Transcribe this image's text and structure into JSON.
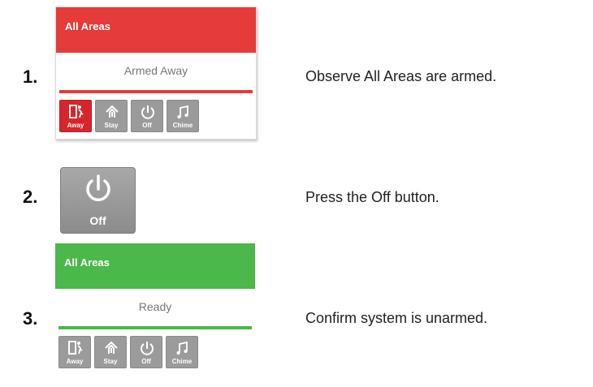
{
  "steps": [
    {
      "number": "1.",
      "text": "Observe All Areas are armed."
    },
    {
      "number": "2.",
      "text": "Press the Off button."
    },
    {
      "number": "3.",
      "text": "Confirm system is unarmed."
    }
  ],
  "panel_armed": {
    "title": "All Areas",
    "status": "Armed Away",
    "header_color": "#e53b3b",
    "bar_color": "#e53b3b",
    "buttons": [
      {
        "label": "Away",
        "icon": "away-door-icon",
        "active": true
      },
      {
        "label": "Stay",
        "icon": "stay-house-icon",
        "active": false
      },
      {
        "label": "Off",
        "icon": "power-icon",
        "active": false
      },
      {
        "label": "Chime",
        "icon": "chime-note-icon",
        "active": false
      }
    ]
  },
  "off_button": {
    "label": "Off",
    "icon": "power-icon"
  },
  "panel_ready": {
    "title": "All Areas",
    "status": "Ready",
    "header_color": "#4ab84a",
    "bar_color": "#4ab84a",
    "buttons": [
      {
        "label": "Away",
        "icon": "away-door-icon",
        "active": false
      },
      {
        "label": "Stay",
        "icon": "stay-house-icon",
        "active": false
      },
      {
        "label": "Off",
        "icon": "power-icon",
        "active": false
      },
      {
        "label": "Chime",
        "icon": "chime-note-icon",
        "active": false
      }
    ]
  }
}
